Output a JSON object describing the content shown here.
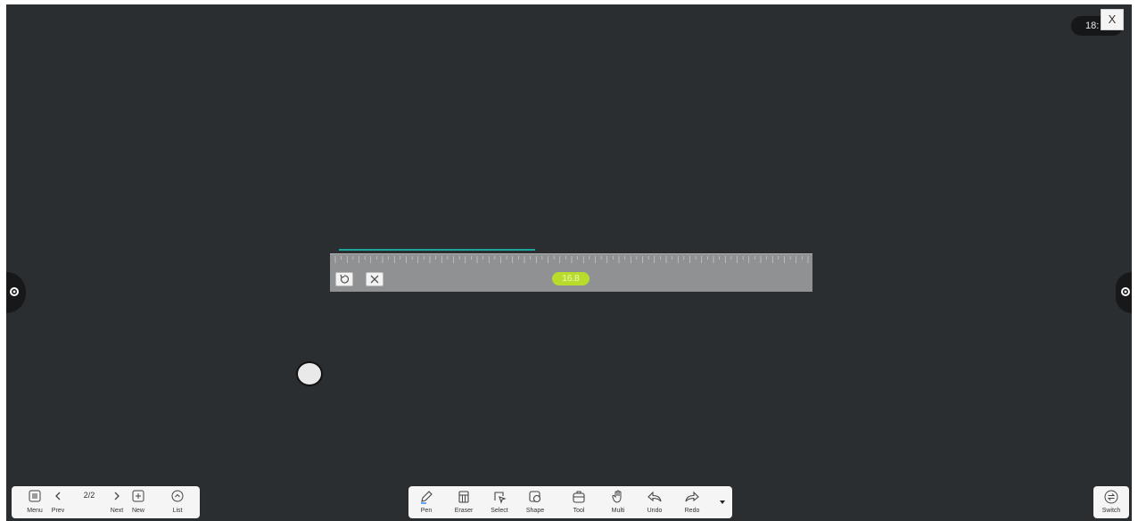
{
  "clock": {
    "time_text": "18:"
  },
  "close_label": "X",
  "ruler": {
    "length_value": "16.8",
    "drawn_mark_count": 81
  },
  "left_toolbar": {
    "menu_label": "Menu",
    "prev_label": "Prev",
    "page_indicator": "2/2",
    "next_label": "Next",
    "new_label": "New",
    "list_label": "List"
  },
  "main_toolbar": {
    "tools": [
      {
        "label": "Pen",
        "icon": "pen-icon"
      },
      {
        "label": "Eraser",
        "icon": "eraser-icon"
      },
      {
        "label": "Select",
        "icon": "select-icon"
      },
      {
        "label": "Shape",
        "icon": "shape-icon"
      },
      {
        "label": "Tool",
        "icon": "toolbox-icon"
      },
      {
        "label": "Multi",
        "icon": "hand-icon"
      },
      {
        "label": "Undo",
        "icon": "undo-icon"
      },
      {
        "label": "Redo",
        "icon": "redo-icon"
      }
    ],
    "more_icon": "caret-down-icon"
  },
  "switch_label": "Switch",
  "colors": {
    "canvas": "#2b2e31",
    "ruler": "#8f9193",
    "ruler_length_badge": "#b7dc2b",
    "drawn_line": "#1aa49a"
  }
}
